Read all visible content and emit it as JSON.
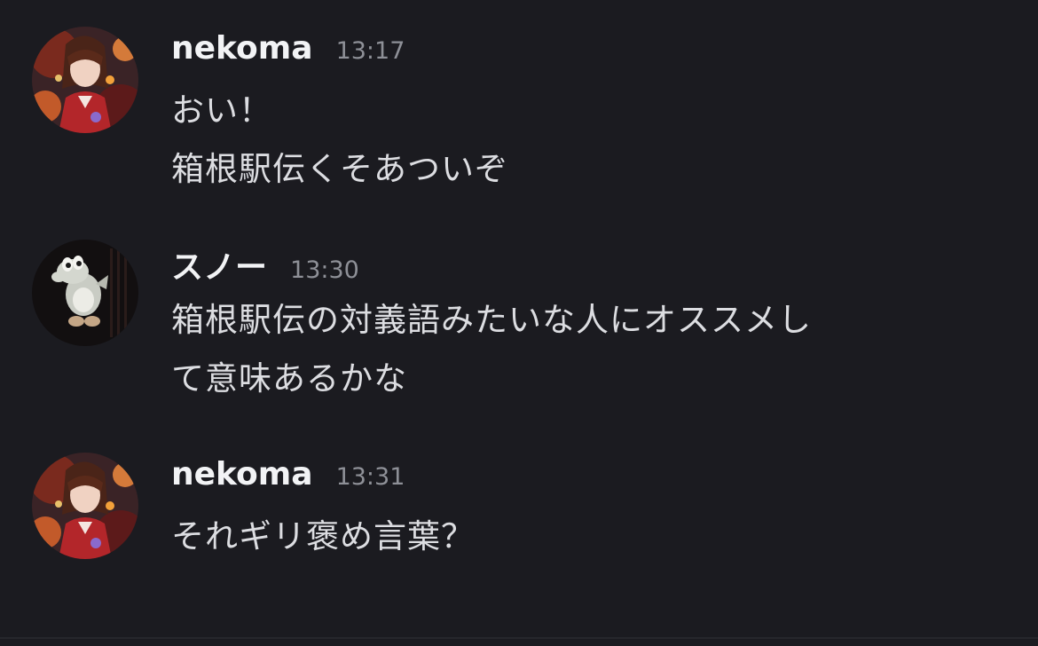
{
  "messages": [
    {
      "author": "nekoma",
      "time": "13:17",
      "avatar_icon": "anime-girl-avatar-icon",
      "lines": [
        "おい！",
        "箱根駅伝くそあついぞ"
      ]
    },
    {
      "author": "スノー",
      "time": "13:30",
      "avatar_icon": "dinosaur-avatar-icon",
      "lines": [
        "箱根駅伝の対義語みたいな人にオススメし",
        "て意味あるかな"
      ]
    },
    {
      "author": "nekoma",
      "time": "13:31",
      "avatar_icon": "anime-girl-avatar-icon",
      "lines": [
        "それギリ褒め言葉？"
      ]
    }
  ],
  "colors": {
    "background": "#1b1b20",
    "username": "#f2f3f5",
    "timestamp": "#8e9097",
    "message_text": "#dcdde1"
  }
}
